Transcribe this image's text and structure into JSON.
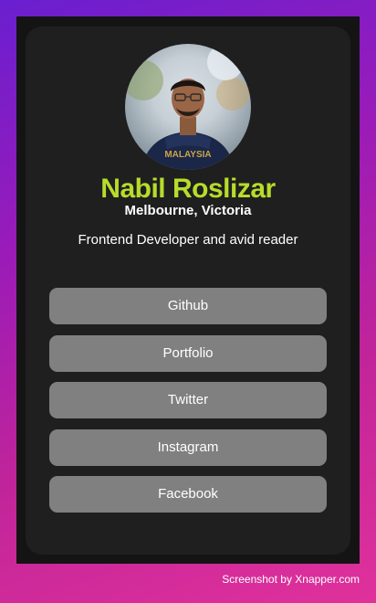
{
  "profile": {
    "name": "Nabil Roslizar",
    "location": "Melbourne, Victoria",
    "bio": "Frontend Developer and avid reader",
    "avatar_icon": "profile-photo",
    "shirt_text": "MALAYSIA"
  },
  "links": [
    {
      "label": "Github"
    },
    {
      "label": "Portfolio"
    },
    {
      "label": "Twitter"
    },
    {
      "label": "Instagram"
    },
    {
      "label": "Facebook"
    }
  ],
  "footer": {
    "credit": "Screenshot by Xnapper.com"
  },
  "colors": {
    "name": "#b7dc2b",
    "card": "#1f1f1f",
    "button": "#808080",
    "frame": "#141414"
  }
}
